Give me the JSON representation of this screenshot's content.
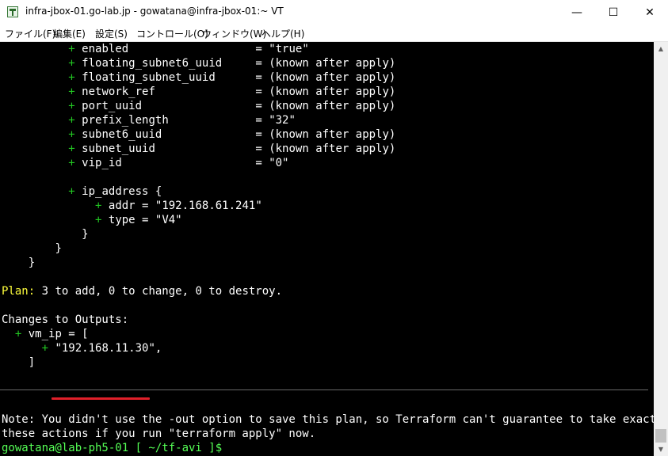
{
  "window": {
    "title": "infra-jbox-01.go-lab.jp - gowatana@infra-jbox-01:~ VT",
    "minimize": "—",
    "maximize": "☐",
    "close": "✕"
  },
  "menu": [
    "ファイル(F)",
    "編集(E)",
    "設定(S)",
    "コントロール(O)",
    "ウィンドウ(W)",
    "ヘルプ(H)"
  ],
  "terminal": {
    "attributes": [
      {
        "sign": "+",
        "name": "enabled              ",
        "value": "= \"true\""
      },
      {
        "sign": "+",
        "name": "floating_subnet6_uuid",
        "value": "= (known after apply)"
      },
      {
        "sign": "+",
        "name": "floating_subnet_uuid ",
        "value": "= (known after apply)"
      },
      {
        "sign": "+",
        "name": "network_ref          ",
        "value": "= (known after apply)"
      },
      {
        "sign": "+",
        "name": "port_uuid            ",
        "value": "= (known after apply)"
      },
      {
        "sign": "+",
        "name": "prefix_length        ",
        "value": "= \"32\""
      },
      {
        "sign": "+",
        "name": "subnet6_uuid         ",
        "value": "= (known after apply)"
      },
      {
        "sign": "+",
        "name": "subnet_uuid          ",
        "value": "= (known after apply)"
      },
      {
        "sign": "+",
        "name": "vip_id               ",
        "value": "= \"0\""
      }
    ],
    "ip_block": {
      "sign": "+",
      "text": "ip_address {"
    },
    "ip_addr": {
      "sign": "+",
      "text": "addr = \"192.168.61.241\""
    },
    "ip_type": {
      "sign": "+",
      "text": "type = \"V4\""
    },
    "brace_inner": "}",
    "brace_mid": "}",
    "brace_outer": "}",
    "plan_label": "Plan:",
    "plan_text": " 3 to add, 0 to change, 0 to destroy.",
    "outputs_header": "Changes to Outputs:",
    "vm_ip": {
      "sign": "+",
      "text": "vm_ip = ["
    },
    "vm_ip_value": {
      "sign": "+",
      "text": "\"192.168.11.30\","
    },
    "vm_ip_close": "]",
    "note_line1": "Note: You didn't use the -out option to save this plan, so Terraform can't guarantee to take exactly",
    "note_line2": "these actions if you run \"terraform apply\" now.",
    "prompt": "gowatana@lab-ph5-01 [ ~/tf-avi ]$"
  }
}
